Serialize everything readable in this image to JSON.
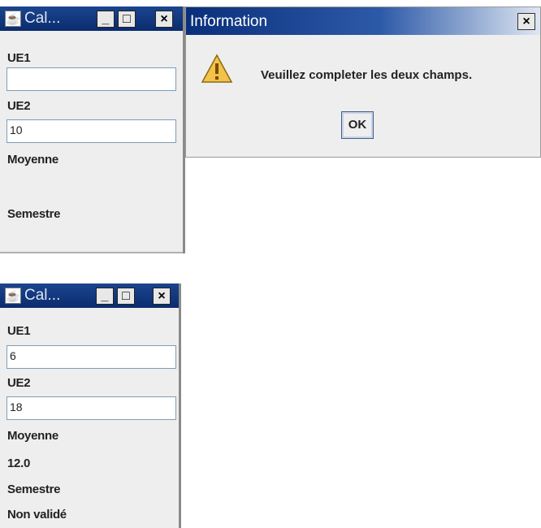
{
  "window1": {
    "title": "Cal...",
    "ue1_label": "UE1",
    "ue1_value": "",
    "ue2_label": "UE2",
    "ue2_value": "10",
    "moyenne_label": "Moyenne",
    "moyenne_value": "",
    "semestre_label": "Semestre",
    "semestre_value": ""
  },
  "dialog": {
    "title": "Information",
    "close_glyph": "×",
    "message": "Veuillez completer les deux champs.",
    "ok_label": "OK",
    "icon": "warning-icon"
  },
  "window2": {
    "title": "Cal...",
    "ue1_label": "UE1",
    "ue1_value": "6",
    "ue2_label": "UE2",
    "ue2_value": "18",
    "moyenne_label": "Moyenne",
    "moyenne_value": "12.0",
    "semestre_label": "Semestre",
    "semestre_value": "Non validé"
  },
  "window_buttons": {
    "minimize": "_",
    "maximize": "□",
    "close": "×"
  },
  "colors": {
    "titlebar": "#0a2c6e",
    "window_bg": "#eeeeee",
    "field_border": "#7f9db9",
    "warning": "#f2c24a"
  }
}
